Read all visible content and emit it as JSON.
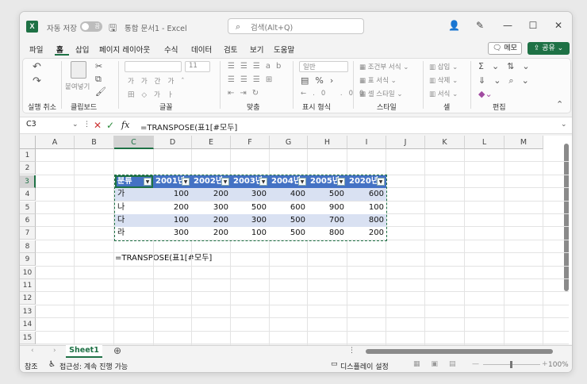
{
  "titlebar": {
    "autosave_label": "자동 저장",
    "autosave_state": "끔",
    "doc_title": "통합 문서1 - Excel",
    "search_placeholder": "검색(Alt+Q)"
  },
  "tabs": [
    "파일",
    "홈",
    "삽입",
    "페이지 레이아웃",
    "수식",
    "데이터",
    "검토",
    "보기",
    "도움말"
  ],
  "active_tab": "홈",
  "memo_label": "메모",
  "share_label": "공유",
  "ribbon": {
    "groups": [
      "실행 취소",
      "클립보드",
      "글꼴",
      "맞춤",
      "표시 형식",
      "스타일",
      "셀",
      "편집"
    ],
    "paste_label": "붙여넣기",
    "font_size": "11",
    "number_format": "일반",
    "style_items": [
      "조건부 서식",
      "표 서식",
      "셀 스타일"
    ],
    "cell_items": [
      "삽입",
      "삭제",
      "서식"
    ]
  },
  "formula_bar": {
    "name_box": "C3",
    "formula": "=TRANSPOSE(표1[#모두]"
  },
  "columns": [
    "A",
    "B",
    "C",
    "D",
    "E",
    "F",
    "G",
    "H",
    "I",
    "J",
    "K",
    "L",
    "M"
  ],
  "rows": [
    "1",
    "2",
    "3",
    "4",
    "5",
    "6",
    "7",
    "8",
    "9",
    "10",
    "11",
    "12",
    "13",
    "14",
    "15"
  ],
  "table": {
    "headers": [
      "분류",
      "2001년",
      "2002년",
      "2003년",
      "2004년",
      "2005년",
      "2020년"
    ],
    "data": [
      [
        "가",
        "100",
        "200",
        "300",
        "400",
        "500",
        "600"
      ],
      [
        "나",
        "200",
        "300",
        "500",
        "600",
        "900",
        "100"
      ],
      [
        "다",
        "100",
        "200",
        "300",
        "500",
        "700",
        "800"
      ],
      [
        "라",
        "300",
        "200",
        "100",
        "500",
        "800",
        "200"
      ]
    ],
    "header_color": "#4472c4",
    "band_color": "#d9e1f2"
  },
  "cell_c9": "=TRANSPOSE(표1[#모두]",
  "sheet_tab": "Sheet1",
  "status": {
    "mode": "참조",
    "accessibility": "접근성: 계속 진행 가능",
    "display_settings": "디스플레이 설정",
    "zoom": "100%"
  }
}
